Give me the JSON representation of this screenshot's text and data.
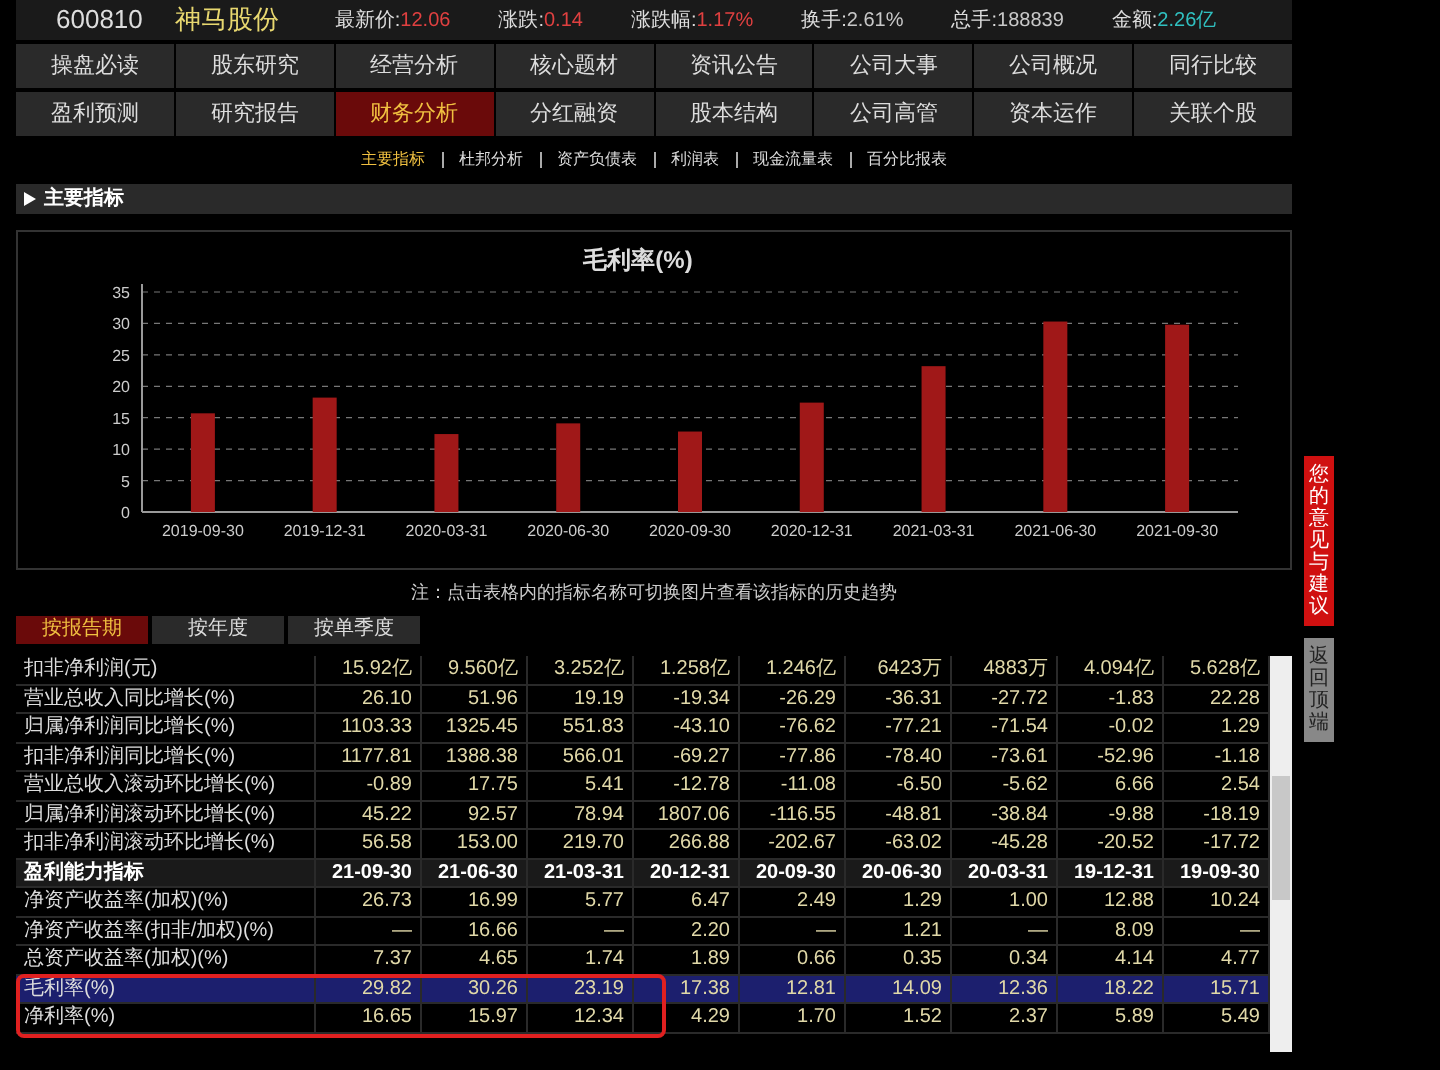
{
  "header": {
    "code": "600810",
    "name": "神马股份",
    "quotes": [
      {
        "label": "最新价:",
        "value": "12.06",
        "color": "#e04040"
      },
      {
        "label": "涨跌:",
        "value": "0.14",
        "color": "#e04040"
      },
      {
        "label": "涨跌幅:",
        "value": "1.17%",
        "color": "#e04040"
      },
      {
        "label": "换手:",
        "value": "2.61%",
        "color": "#c8c8c8"
      },
      {
        "label": "总手:",
        "value": "188839",
        "color": "#c8c8c8"
      },
      {
        "label": "金额:",
        "value": "2.26亿",
        "color": "#30c0c0"
      }
    ]
  },
  "nav_rows": [
    [
      {
        "label": "操盘必读",
        "selected": false
      },
      {
        "label": "股东研究",
        "selected": false
      },
      {
        "label": "经营分析",
        "selected": false
      },
      {
        "label": "核心题材",
        "selected": false
      },
      {
        "label": "资讯公告",
        "selected": false
      },
      {
        "label": "公司大事",
        "selected": false
      },
      {
        "label": "公司概况",
        "selected": false
      },
      {
        "label": "同行比较",
        "selected": false
      }
    ],
    [
      {
        "label": "盈利预测",
        "selected": false
      },
      {
        "label": "研究报告",
        "selected": false
      },
      {
        "label": "财务分析",
        "selected": true
      },
      {
        "label": "分红融资",
        "selected": false
      },
      {
        "label": "股本结构",
        "selected": false
      },
      {
        "label": "公司高管",
        "selected": false
      },
      {
        "label": "资本运作",
        "selected": false
      },
      {
        "label": "关联个股",
        "selected": false
      }
    ]
  ],
  "subnav": [
    {
      "label": "主要指标",
      "selected": true
    },
    {
      "label": "杜邦分析",
      "selected": false
    },
    {
      "label": "资产负债表",
      "selected": false
    },
    {
      "label": "利润表",
      "selected": false
    },
    {
      "label": "现金流量表",
      "selected": false
    },
    {
      "label": "百分比报表",
      "selected": false
    }
  ],
  "section": {
    "title": "主要指标"
  },
  "chart": {
    "chart_data": {
      "type": "bar",
      "title": "毛利率(%)",
      "categories": [
        "2019-09-30",
        "2019-12-31",
        "2020-03-31",
        "2020-06-30",
        "2020-09-30",
        "2020-12-31",
        "2021-03-31",
        "2021-06-30",
        "2021-09-30"
      ],
      "series": [
        {
          "color": "#a01818",
          "values": [
            15.7,
            18.2,
            12.4,
            14.1,
            12.8,
            17.4,
            23.2,
            30.3,
            29.8
          ]
        }
      ],
      "grid": true,
      "ylim": [
        0,
        35
      ],
      "yticks": [
        0,
        5,
        10,
        15,
        20,
        25,
        30,
        35
      ]
    }
  },
  "note": "注：点击表格内的指标名称可切换图片查看该指标的历史趋势",
  "table_tabs": [
    {
      "label": "按报告期",
      "selected": true
    },
    {
      "label": "按年度",
      "selected": false
    },
    {
      "label": "按单季度",
      "selected": false
    }
  ],
  "table_rows": [
    {
      "kind": "data",
      "name": "扣非净利润(元)",
      "selected": false,
      "outlined": false,
      "values": [
        "15.92亿",
        "9.560亿",
        "3.252亿",
        "1.258亿",
        "1.246亿",
        "6423万",
        "4883万",
        "4.094亿",
        "5.628亿"
      ]
    },
    {
      "kind": "data",
      "name": "营业总收入同比增长(%)",
      "selected": false,
      "outlined": false,
      "values": [
        "26.10",
        "51.96",
        "19.19",
        "-19.34",
        "-26.29",
        "-36.31",
        "-27.72",
        "-1.83",
        "22.28"
      ]
    },
    {
      "kind": "data",
      "name": "归属净利润同比增长(%)",
      "selected": false,
      "outlined": false,
      "values": [
        "1103.33",
        "1325.45",
        "551.83",
        "-43.10",
        "-76.62",
        "-77.21",
        "-71.54",
        "-0.02",
        "1.29"
      ]
    },
    {
      "kind": "data",
      "name": "扣非净利润同比增长(%)",
      "selected": false,
      "outlined": false,
      "values": [
        "1177.81",
        "1388.38",
        "566.01",
        "-69.27",
        "-77.86",
        "-78.40",
        "-73.61",
        "-52.96",
        "-1.18"
      ]
    },
    {
      "kind": "data",
      "name": "营业总收入滚动环比增长(%)",
      "selected": false,
      "outlined": false,
      "values": [
        "-0.89",
        "17.75",
        "5.41",
        "-12.78",
        "-11.08",
        "-6.50",
        "-5.62",
        "6.66",
        "2.54"
      ]
    },
    {
      "kind": "data",
      "name": "归属净利润滚动环比增长(%)",
      "selected": false,
      "outlined": false,
      "values": [
        "45.22",
        "92.57",
        "78.94",
        "1807.06",
        "-116.55",
        "-48.81",
        "-38.84",
        "-9.88",
        "-18.19"
      ]
    },
    {
      "kind": "data",
      "name": "扣非净利润滚动环比增长(%)",
      "selected": false,
      "outlined": false,
      "values": [
        "56.58",
        "153.00",
        "219.70",
        "266.88",
        "-202.67",
        "-63.02",
        "-45.28",
        "-20.52",
        "-17.72"
      ]
    },
    {
      "kind": "group",
      "name": "盈利能力指标",
      "selected": false,
      "outlined": false,
      "values": [
        "21-09-30",
        "21-06-30",
        "21-03-31",
        "20-12-31",
        "20-09-30",
        "20-06-30",
        "20-03-31",
        "19-12-31",
        "19-09-30"
      ]
    },
    {
      "kind": "data",
      "name": "净资产收益率(加权)(%)",
      "selected": false,
      "outlined": false,
      "values": [
        "26.73",
        "16.99",
        "5.77",
        "6.47",
        "2.49",
        "1.29",
        "1.00",
        "12.88",
        "10.24"
      ]
    },
    {
      "kind": "data",
      "name": "净资产收益率(扣非/加权)(%)",
      "selected": false,
      "outlined": false,
      "values": [
        "—",
        "16.66",
        "—",
        "2.20",
        "—",
        "1.21",
        "—",
        "8.09",
        "—"
      ]
    },
    {
      "kind": "data",
      "name": "总资产收益率(加权)(%)",
      "selected": false,
      "outlined": false,
      "values": [
        "7.37",
        "4.65",
        "1.74",
        "1.89",
        "0.66",
        "0.35",
        "0.34",
        "4.14",
        "4.77"
      ]
    },
    {
      "kind": "data",
      "name": "毛利率(%)",
      "selected": true,
      "outlined": true,
      "values": [
        "29.82",
        "30.26",
        "23.19",
        "17.38",
        "12.81",
        "14.09",
        "12.36",
        "18.22",
        "15.71"
      ]
    },
    {
      "kind": "data",
      "name": "净利率(%)",
      "selected": false,
      "outlined": true,
      "values": [
        "16.65",
        "15.97",
        "12.34",
        "4.29",
        "1.70",
        "1.52",
        "2.37",
        "5.89",
        "5.49"
      ]
    }
  ],
  "side_buttons": [
    {
      "kind": "feedback",
      "label": "您的意见与建议"
    },
    {
      "kind": "top",
      "label": "返回顶端"
    }
  ]
}
